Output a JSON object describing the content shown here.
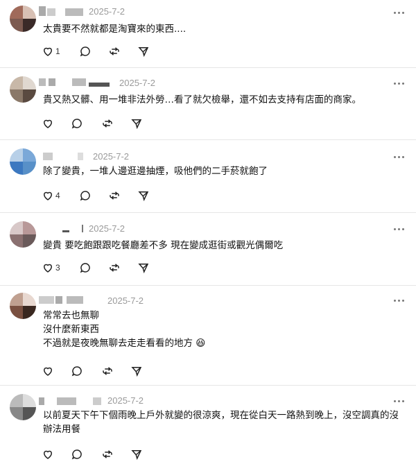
{
  "comments": [
    {
      "date": "2025-7-2",
      "text": "太貴要不然就都是淘寶來的東西....",
      "like_count": "1",
      "colors": [
        "#a06a5a",
        "#3a2a28",
        "#d8c0b4",
        "#7c5a50"
      ]
    },
    {
      "date": "2025-7-2",
      "text": "貴又熱又髒、用一堆非法外勞…看了就欠檢舉，還不如去支持有店面的商家。",
      "like_count": "",
      "colors": [
        "#8a7868",
        "#c8b8a8",
        "#5a4a40",
        "#e0d8d0"
      ]
    },
    {
      "date": "2025-7-2",
      "text": "除了變貴，一堆人邊逛邊抽煙，吸他們的二手菸就飽了",
      "like_count": "4",
      "colors": [
        "#7aa8d8",
        "#3c78c0",
        "#b8d0e8",
        "#5890c8"
      ]
    },
    {
      "date": "2025-7-2",
      "text": "變貴 要吃飽跟跟吃餐廳差不多 現在變成逛街或觀光偶爾吃",
      "like_count": "3",
      "colors": [
        "#b89898",
        "#6a5a5a",
        "#d8c8c8",
        "#8a7070"
      ]
    },
    {
      "date": "2025-7-2",
      "text": "常常去也無聊\n沒什麼新東西\n不過就是夜晚無聊去走走看看的地方 😆",
      "like_count": "",
      "colors": [
        "#7a5040",
        "#c0a090",
        "#3a2820",
        "#e8d8d0"
      ]
    },
    {
      "date": "2025-7-2",
      "text": "以前夏天下午下個雨晚上戶外就變的很涼爽，現在從白天一路熱到晚上，沒空調真的沒辦法用餐",
      "like_count": "",
      "colors": [
        "#888888",
        "#bbbbbb",
        "#555555",
        "#dddddd"
      ]
    }
  ],
  "icons": {
    "like": "heart-icon",
    "reply": "comment-bubble-icon",
    "repost": "repost-icon",
    "share": "send-icon",
    "more": "more-dots-icon"
  }
}
